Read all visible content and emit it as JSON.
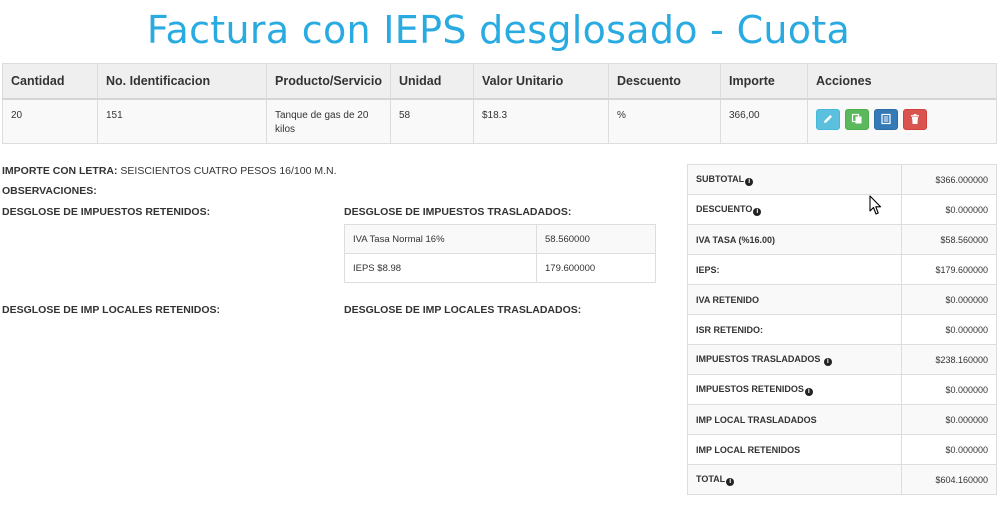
{
  "title": "Factura con IEPS desglosado - Cuota",
  "items_table": {
    "headers": [
      "Cantidad",
      "No. Identificacion",
      "Producto/Servicio",
      "Unidad",
      "Valor Unitario",
      "Descuento",
      "Importe",
      "Acciones"
    ],
    "rows": [
      [
        "20",
        "151",
        "Tanque de gas de 20 kilos",
        "58",
        "$18.3",
        "%",
        "366,00"
      ]
    ],
    "action_icons": [
      "pencil-icon",
      "copy-icon",
      "list-icon",
      "trash-icon"
    ],
    "action_colors": [
      "#5bc0de",
      "#5cb85c",
      "#337ab7",
      "#d9534f"
    ]
  },
  "details": {
    "importe_label": "IMPORTE CON LETRA:",
    "importe_value": "SEISCIENTOS CUATRO PESOS 16/100 M.N.",
    "observaciones_label": "OBSERVACIONES:",
    "retenidos_label": "DESGLOSE DE IMPUESTOS RETENIDOS:",
    "trasladados_label": "DESGLOSE DE IMPUESTOS TRASLADADOS:",
    "locales_retenidos_label": "DESGLOSE DE IMP LOCALES RETENIDOS:",
    "locales_trasladados_label": "DESGLOSE DE IMP LOCALES TRASLADADOS:"
  },
  "taxes_trasladados": [
    [
      "IVA Tasa Normal 16%",
      "58.560000"
    ],
    [
      "IEPS $8.98",
      "179.600000"
    ]
  ],
  "summary": [
    {
      "label": "SUBTOTAL",
      "info": true,
      "value": "$366.000000"
    },
    {
      "label": "DESCUENTO",
      "info": true,
      "value": "$0.000000"
    },
    {
      "label": "IVA TASA (%16.00)",
      "info": false,
      "value": "$58.560000"
    },
    {
      "label": "IEPS:",
      "info": false,
      "value": "$179.600000"
    },
    {
      "label": "IVA RETENIDO",
      "info": false,
      "value": "$0.000000"
    },
    {
      "label": "ISR RETENIDO:",
      "info": false,
      "value": "$0.000000"
    },
    {
      "label": "IMPUESTOS TRASLADADOS ",
      "info": true,
      "value": "$238.160000"
    },
    {
      "label": "IMPUESTOS RETENIDOS",
      "info": true,
      "value": "$0.000000"
    },
    {
      "label": "IMP LOCAL TRASLADADOS",
      "info": false,
      "value": "$0.000000"
    },
    {
      "label": "IMP LOCAL RETENIDOS",
      "info": false,
      "value": "$0.000000"
    },
    {
      "label": "TOTAL",
      "info": true,
      "value": "$604.160000"
    }
  ],
  "colors": {
    "title": "#29abe2",
    "header_bg": "#efefef",
    "border": "#dddddd"
  }
}
